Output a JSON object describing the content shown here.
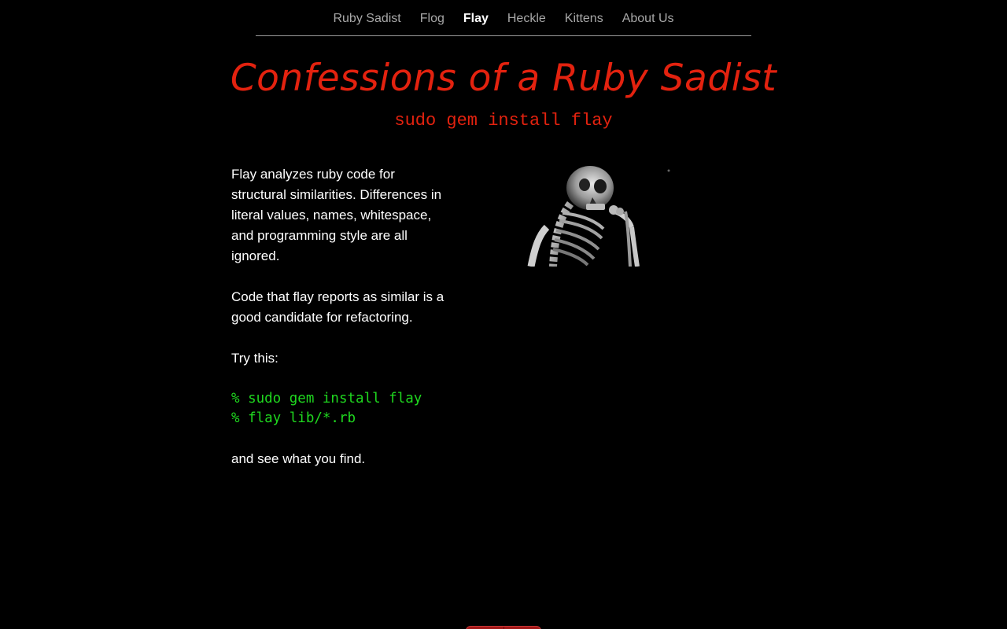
{
  "nav": {
    "items": [
      {
        "label": "Ruby Sadist",
        "active": false
      },
      {
        "label": "Flog",
        "active": false
      },
      {
        "label": "Flay",
        "active": true
      },
      {
        "label": "Heckle",
        "active": false
      },
      {
        "label": "Kittens",
        "active": false
      },
      {
        "label": "About Us",
        "active": false
      }
    ]
  },
  "header": {
    "title": "Confessions of a Ruby Sadist",
    "subtitle": "sudo gem install flay"
  },
  "main": {
    "paragraphs": [
      "Flay analyzes ruby code for structural similarities. Differences in literal values, names, whitespace, and programming style are all ignored.",
      "Code that flay reports as similar is a good candidate for refactoring.",
      "Try this:"
    ],
    "code_lines": [
      "% sudo gem install flay",
      "% flay lib/*.rb"
    ],
    "closing": "and see what you find."
  },
  "image": {
    "icon": "thinking-skeleton-image"
  },
  "colors": {
    "background": "#000000",
    "title": "#e3220f",
    "code": "#1fd81f",
    "nav_inactive": "#a8a8a8",
    "nav_active": "#ffffff"
  }
}
